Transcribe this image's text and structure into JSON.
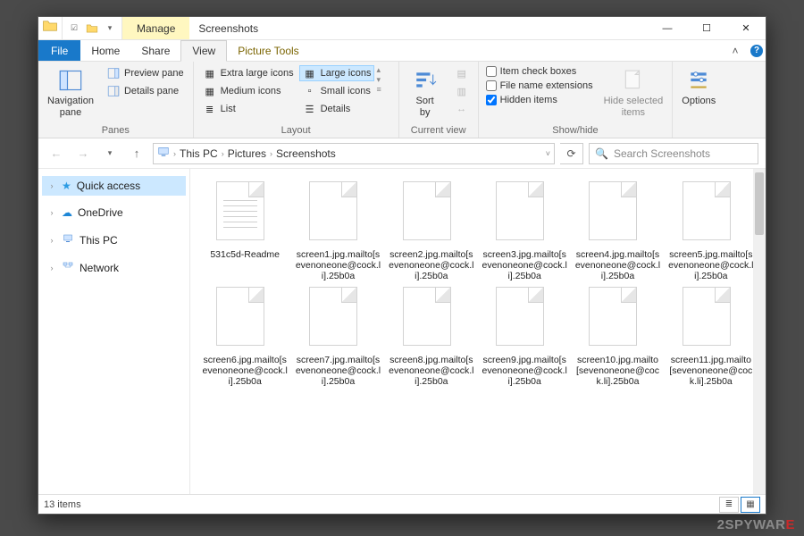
{
  "titlebar": {
    "context_tab": "Manage",
    "title": "Screenshots"
  },
  "ribbon_tabs": {
    "file": "File",
    "home": "Home",
    "share": "Share",
    "view": "View",
    "picture_tools": "Picture Tools"
  },
  "ribbon": {
    "panes": {
      "nav": "Navigation\npane",
      "preview": "Preview pane",
      "details": "Details pane",
      "group": "Panes"
    },
    "layout": {
      "xl": "Extra large icons",
      "large": "Large icons",
      "medium": "Medium icons",
      "small": "Small icons",
      "list": "List",
      "details": "Details",
      "group": "Layout"
    },
    "current": {
      "sort": "Sort\nby",
      "group": "Current view"
    },
    "showhide": {
      "chk1": "Item check boxes",
      "chk2": "File name extensions",
      "chk3": "Hidden items",
      "hide": "Hide selected\nitems",
      "group": "Show/hide"
    },
    "options": "Options"
  },
  "breadcrumb": {
    "a": "This PC",
    "b": "Pictures",
    "c": "Screenshots"
  },
  "search": {
    "placeholder": "Search Screenshots"
  },
  "sidebar": {
    "quick": "Quick access",
    "onedrive": "OneDrive",
    "thispc": "This PC",
    "network": "Network"
  },
  "files": [
    {
      "name": "531c5d-Readme",
      "kind": "text"
    },
    {
      "name": "screen1.jpg.mailto[sevenoneone@cock.li].25b0a",
      "kind": "blank"
    },
    {
      "name": "screen2.jpg.mailto[sevenoneone@cock.li].25b0a",
      "kind": "blank"
    },
    {
      "name": "screen3.jpg.mailto[sevenoneone@cock.li].25b0a",
      "kind": "blank"
    },
    {
      "name": "screen4.jpg.mailto[sevenoneone@cock.li].25b0a",
      "kind": "blank"
    },
    {
      "name": "screen5.jpg.mailto[sevenoneone@cock.li].25b0a",
      "kind": "blank"
    },
    {
      "name": "screen6.jpg.mailto[sevenoneone@cock.li].25b0a",
      "kind": "blank"
    },
    {
      "name": "screen7.jpg.mailto[sevenoneone@cock.li].25b0a",
      "kind": "blank"
    },
    {
      "name": "screen8.jpg.mailto[sevenoneone@cock.li].25b0a",
      "kind": "blank"
    },
    {
      "name": "screen9.jpg.mailto[sevenoneone@cock.li].25b0a",
      "kind": "blank"
    },
    {
      "name": "screen10.jpg.mailto[sevenoneone@cock.li].25b0a",
      "kind": "blank"
    },
    {
      "name": "screen11.jpg.mailto[sevenoneone@cock.li].25b0a",
      "kind": "blank"
    }
  ],
  "status": {
    "count": "13 items"
  },
  "watermark": {
    "a": "2SPYWAR",
    "b": "E"
  }
}
